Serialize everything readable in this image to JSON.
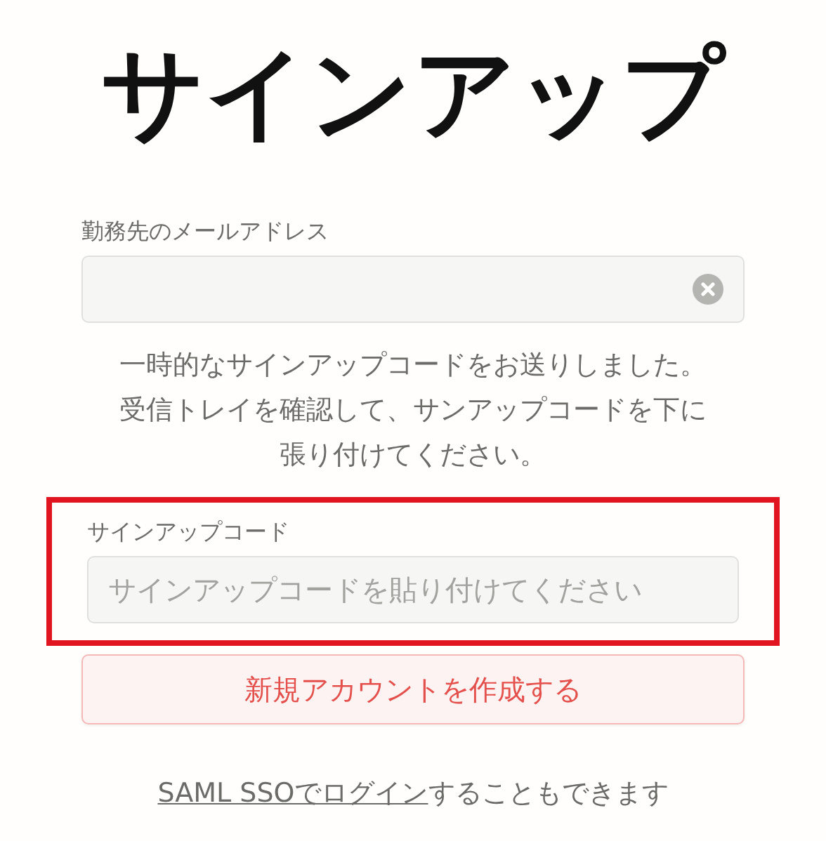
{
  "title": "サインアップ",
  "email_field": {
    "label": "勤務先のメールアドレス",
    "clearable": true
  },
  "message_lines": [
    "一時的なサインアップコードをお送りしました。",
    "受信トレイを確認して、サンアップコードを下に",
    "張り付けてください。"
  ],
  "code_field": {
    "label": "サインアップコード",
    "placeholder": "サインアップコードを貼り付けてください",
    "highlighted": true
  },
  "submit_button": {
    "label": "新規アカウントを作成する"
  },
  "footer": {
    "link": "SAML SSOでログイン",
    "text": "することもできます"
  }
}
